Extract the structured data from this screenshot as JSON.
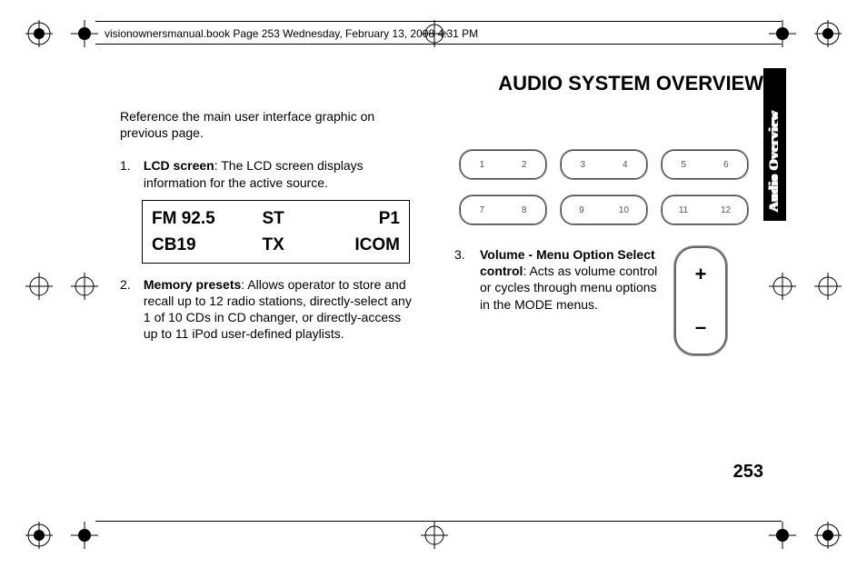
{
  "header": {
    "running_head": "visionownersmanual.book  Page 253  Wednesday, February 13, 2008  4:31 PM"
  },
  "title": "AUDIO SYSTEM OVERVIEW",
  "side_tab": "Audio Overview",
  "intro": "Reference the main user interface graphic on previous page.",
  "items": {
    "one": {
      "num": "1.",
      "label": "LCD screen",
      "rest": ": The LCD screen displays information for the active source."
    },
    "two": {
      "num": "2.",
      "label": "Memory presets",
      "rest": ": Allows operator to store and recall up to 12 radio stations, directly-select any 1 of 10 CDs in CD changer, or directly-access up to 11 iPod user-defined playlists."
    },
    "three": {
      "num": "3.",
      "label": "Volume - Menu Option Select control",
      "rest": ": Acts as volume control or cycles through menu options in the MODE menus."
    }
  },
  "lcd": {
    "r1c1": "FM  92.5",
    "r1c2": "ST",
    "r1c3": "P1",
    "r2c1": "CB19",
    "r2c2": "TX",
    "r2c3": "ICOM"
  },
  "presets": {
    "b1a": "1",
    "b1b": "2",
    "b2a": "3",
    "b2b": "4",
    "b3a": "5",
    "b3b": "6",
    "b4a": "7",
    "b4b": "8",
    "b5a": "9",
    "b5b": "10",
    "b6a": "11",
    "b6b": "12"
  },
  "volume": {
    "plus": "+",
    "minus": "–"
  },
  "page_number": "253"
}
